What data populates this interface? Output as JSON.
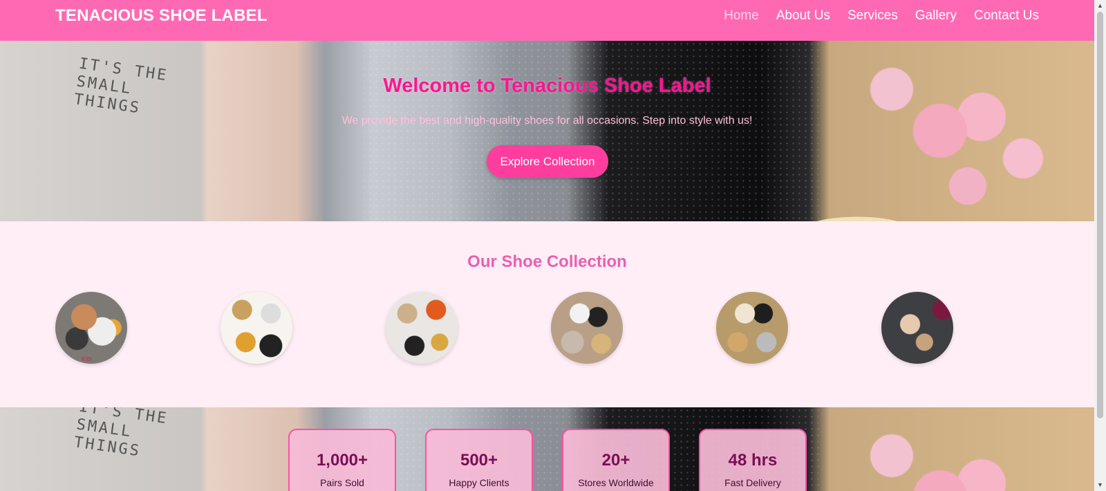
{
  "header": {
    "brand": "TENACIOUS SHOE LABEL",
    "nav": [
      "Home",
      "About Us",
      "Services",
      "Gallery",
      "Contact Us"
    ]
  },
  "hero": {
    "title": "Welcome to Tenacious Shoe Label",
    "subtitle": "We provide the best and high-quality shoes for all occasions. Step into style with us!",
    "cta_label": "Explore Collection",
    "photo_text": "IT'S THE SMALL THINGS"
  },
  "collection": {
    "title": "Our Shoe Collection",
    "first_image_label": "Kibi"
  },
  "stats": [
    {
      "value": "1,000+",
      "label": "Pairs Sold"
    },
    {
      "value": "500+",
      "label": "Happy Clients"
    },
    {
      "value": "20+",
      "label": "Stores Worldwide"
    },
    {
      "value": "48 hrs",
      "label": "Fast Delivery"
    }
  ],
  "colors": {
    "header_bg": "#ff69b4",
    "accent": "#ff1493",
    "button_bg": "#ff3d9e",
    "section_bg": "#ffeef6",
    "stat_value": "#7a0d57"
  },
  "icons": {
    "scroll_up": "▲",
    "scroll_down": "▼"
  }
}
